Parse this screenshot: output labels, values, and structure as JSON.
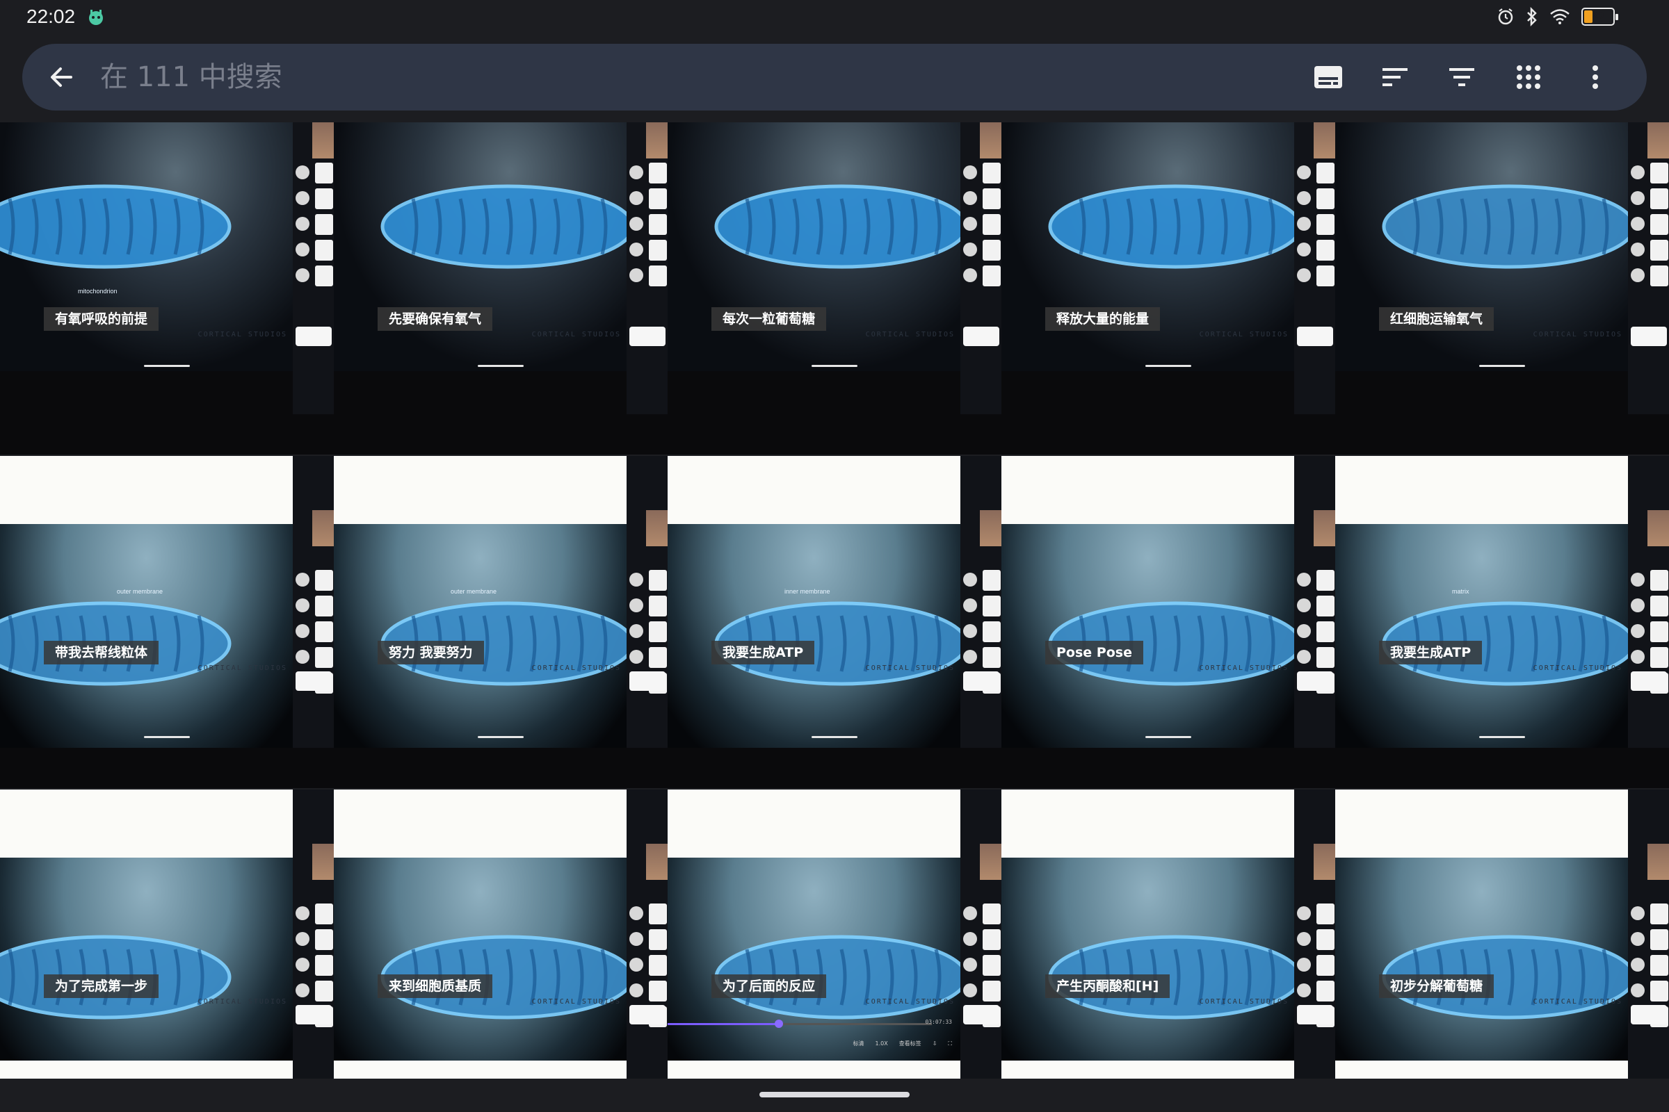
{
  "status_bar": {
    "time": "22:02",
    "battery_level": "29",
    "icons": [
      "robot-icon",
      "alarm-icon",
      "bluetooth-icon",
      "wifi-icon",
      "battery-icon"
    ]
  },
  "search": {
    "placeholder": "在 111 中搜索",
    "value": ""
  },
  "toolbar": {
    "buttons": [
      "subtitles-icon",
      "sort-icon",
      "filter-icon",
      "grid-view-icon",
      "more-vert-icon"
    ]
  },
  "tiles": [
    {
      "caption": "有氧呼吸的前提",
      "label": "mitochondrion"
    },
    {
      "caption": "先要确保有氧气"
    },
    {
      "caption": "每次一粒葡萄糖"
    },
    {
      "caption": "释放大量的能量"
    },
    {
      "caption": "红细胞运输氧气"
    },
    {
      "caption": "带我去帮线粒体",
      "label": "outer membrane"
    },
    {
      "caption": "努力 我要努力",
      "label": "outer membrane"
    },
    {
      "caption": "我要生成ATP",
      "label": "inner membrane"
    },
    {
      "caption": "Pose Pose"
    },
    {
      "caption": "我要生成ATP",
      "label": "matrix"
    },
    {
      "caption": "为了完成第一步"
    },
    {
      "caption": "来到细胞质基质"
    },
    {
      "caption": "为了后面的反应"
    },
    {
      "caption": "产生丙酮酸和[H]"
    },
    {
      "caption": "初步分解葡萄糖"
    }
  ],
  "mini_labels": {
    "atp": "ATP",
    "watermark": "CORTICAL STUDIOS"
  },
  "player": {
    "progress": 0.42,
    "time": "03:07:33",
    "quality": "标清",
    "speed": "1.0X",
    "subtitle": "查看标签",
    "accent": "#7b5cff"
  },
  "colors": {
    "background": "#1c1d21",
    "search_bar": "#2f3646",
    "battery": "#f0a020",
    "mito_blue": "#2f8fd6"
  }
}
